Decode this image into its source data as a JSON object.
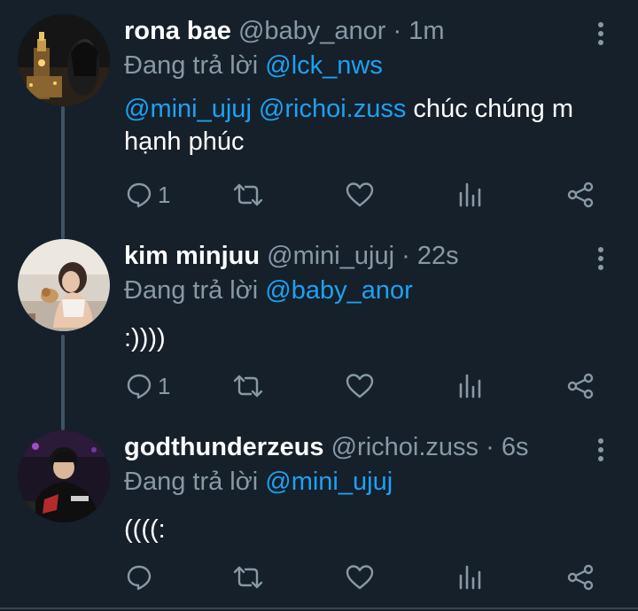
{
  "theme": {
    "background": "#15202b",
    "accent": "#1da1f2",
    "muted": "#8899a6",
    "thread_line": "#3d5466"
  },
  "reply_prefix": "Đang trả lời",
  "tweets": [
    {
      "display_name": "rona bae",
      "handle": "@baby_anor",
      "time": "1m",
      "reply_to": "@lck_nws",
      "body_mentions": "@mini_ujuj @richoi.zuss",
      "body_text": " chúc chúng m hạnh phúc",
      "reply_count": "1",
      "icons": [
        "reply-icon",
        "retweet-icon",
        "like-icon",
        "analytics-icon",
        "share-icon",
        "more-icon"
      ]
    },
    {
      "display_name": "kim minjuu",
      "handle": "@mini_ujuj",
      "time": "22s",
      "reply_to": "@baby_anor",
      "body_mentions": "",
      "body_text": ":))))",
      "reply_count": "1",
      "icons": [
        "reply-icon",
        "retweet-icon",
        "like-icon",
        "analytics-icon",
        "share-icon",
        "more-icon"
      ]
    },
    {
      "display_name": "godthunderzeus",
      "handle": "@richoi.zuss",
      "time": "6s",
      "reply_to": "@mini_ujuj",
      "body_mentions": "",
      "body_text": "((((:",
      "reply_count": "",
      "icons": [
        "reply-icon",
        "retweet-icon",
        "like-icon",
        "analytics-icon",
        "share-icon",
        "more-icon"
      ]
    }
  ]
}
